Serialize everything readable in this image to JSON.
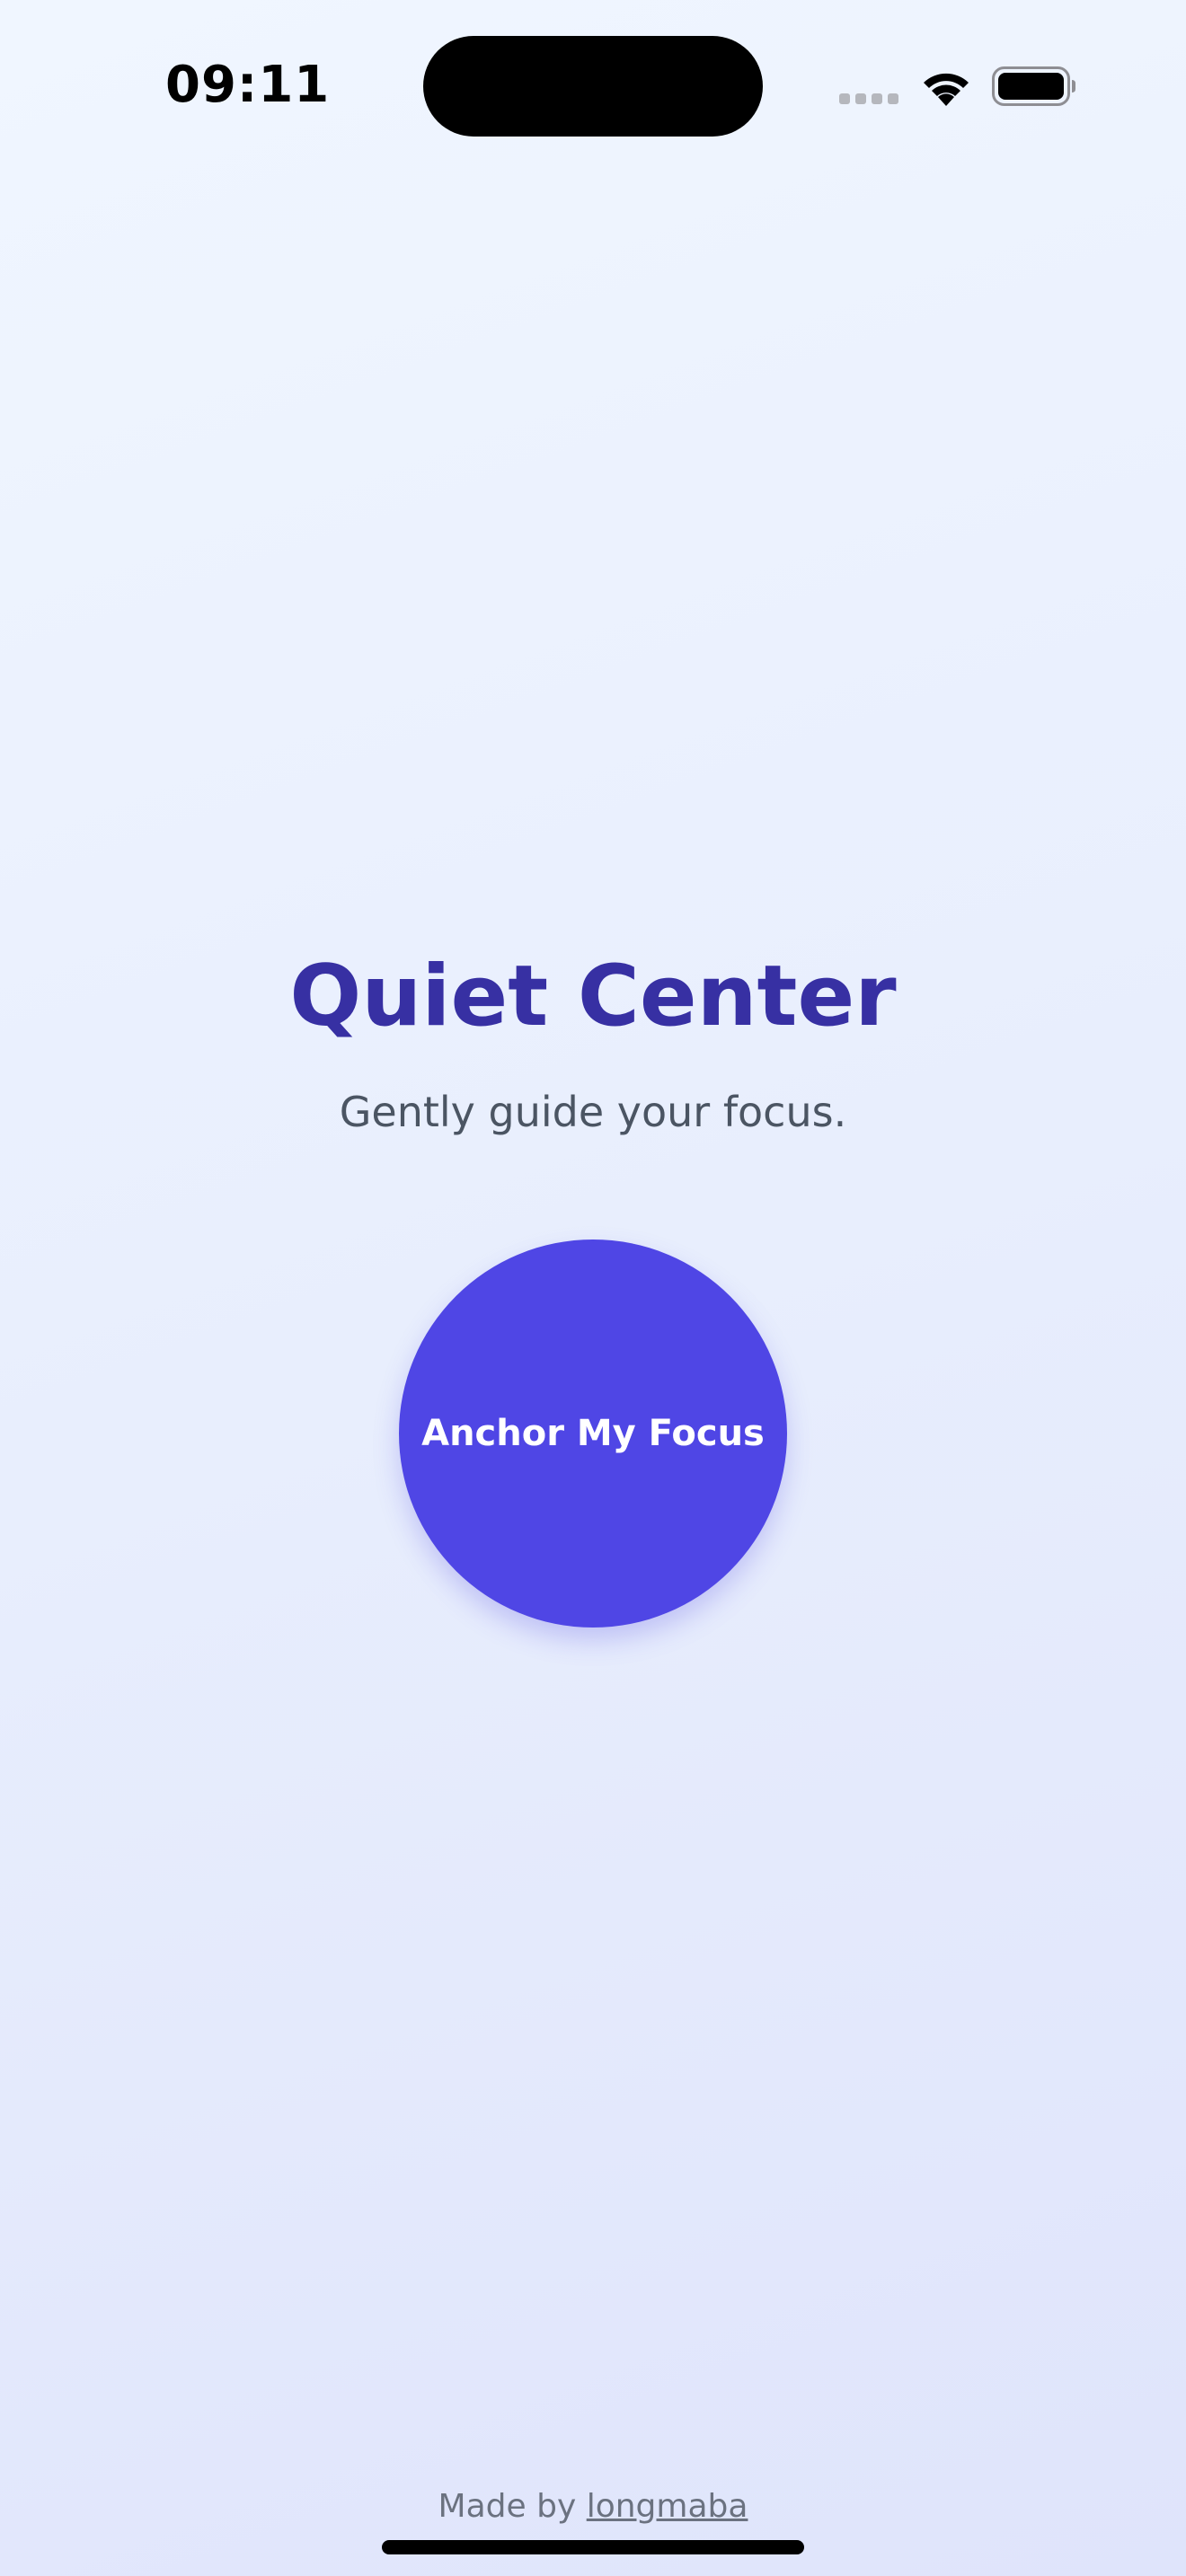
{
  "status_bar": {
    "time": "09:11",
    "icons": [
      "signal-icon",
      "wifi-icon",
      "battery-icon"
    ]
  },
  "main": {
    "title": "Quiet Center",
    "subtitle": "Gently guide your focus.",
    "button_label": "Anchor My Focus"
  },
  "footer": {
    "prefix": "Made by ",
    "link_text": "longmaba"
  },
  "colors": {
    "accent": "#4f46e5",
    "title": "#3730a3",
    "subtitle": "#4b5563",
    "footer": "#6b7280"
  }
}
